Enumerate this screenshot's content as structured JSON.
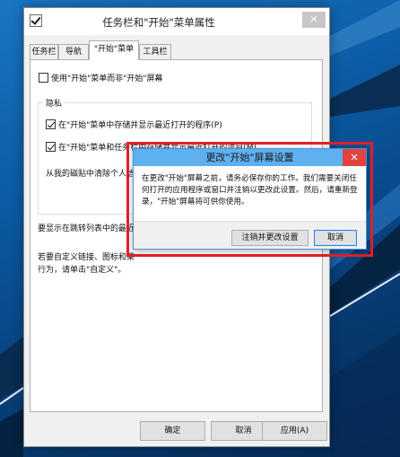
{
  "window": {
    "title": "任务栏和\"开始\"菜单属性",
    "close_glyph": "✕"
  },
  "tabs": [
    {
      "label": "任务栏"
    },
    {
      "label": "导航"
    },
    {
      "label": "\"开始\"菜单",
      "active": true
    },
    {
      "label": "工具栏"
    }
  ],
  "panel": {
    "use_start_screen": {
      "label": "使用\"开始\"菜单而非\"开始\"屏幕",
      "checked": false
    },
    "privacy": {
      "legend": "隐私",
      "store_programs": {
        "label": "在\"开始\"菜单中存储并显示最近打开的程序(P)",
        "checked": true
      },
      "store_items": {
        "label": "在\"开始\"菜单和任务栏中存储并显示最近打开的项目(M)",
        "checked": true
      },
      "clear_text": "从我的磁贴中清除个人信"
    },
    "jumplist_text": "要显示在跳转列表中的最近",
    "customize_line1": "若要自定义链接、图标和菜",
    "customize_line2": "行为，请单击\"自定义\"。"
  },
  "footer": {
    "ok": "确定",
    "cancel": "取消",
    "apply": "应用(A)"
  },
  "dialog": {
    "title": "更改\"开始\"屏幕设置",
    "close_glyph": "✕",
    "message": "在更改\"开始\"屏幕之前，请务必保存你的工作。我们需要关闭任何打开的应用程序或窗口并注销以更改此设置。然后，请重新登录，\"开始\"屏幕将可供你使用。",
    "signout_button": "注销并更改设置",
    "cancel_button": "取消"
  },
  "colors": {
    "highlight_border": "#e3212b",
    "dialog_title_bar": "#5fb0f0",
    "dialog_close": "#e0443d",
    "desktop": "#0b5aa3"
  }
}
